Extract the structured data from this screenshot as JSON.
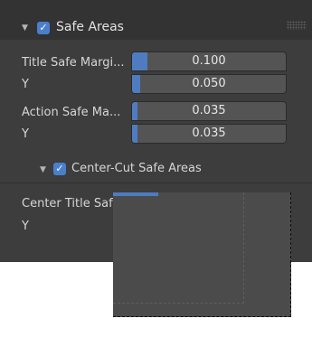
{
  "colors": {
    "panel_bg": "#3d3d3d",
    "header_bg": "#333333",
    "checkbox_blue": "#4a7fcc",
    "field_bg": "#545454",
    "field_fill": "#4f7cc1",
    "text": "#d6d6d6"
  },
  "icons": {
    "expand": "disclosure-triangle-down",
    "check": "checkmark"
  },
  "safe_areas": {
    "title": "Safe Areas",
    "checked": true,
    "title_safe_label": "Title Safe Margi...",
    "title_safe_x": "0.100",
    "title_safe_x_fill": 0.1,
    "title_safe_y_label": "Y",
    "title_safe_y": "0.050",
    "title_safe_y_fill": 0.05,
    "action_safe_label": "Action Safe Ma...",
    "action_safe_x": "0.035",
    "action_safe_x_fill": 0.035,
    "action_safe_y_label": "Y",
    "action_safe_y": "0.035",
    "action_safe_y_fill": 0.035
  },
  "center_cut": {
    "title": "Center-Cut Safe Areas",
    "checked": true,
    "center_title_label": "Center Title Saf",
    "y_label": "Y"
  }
}
